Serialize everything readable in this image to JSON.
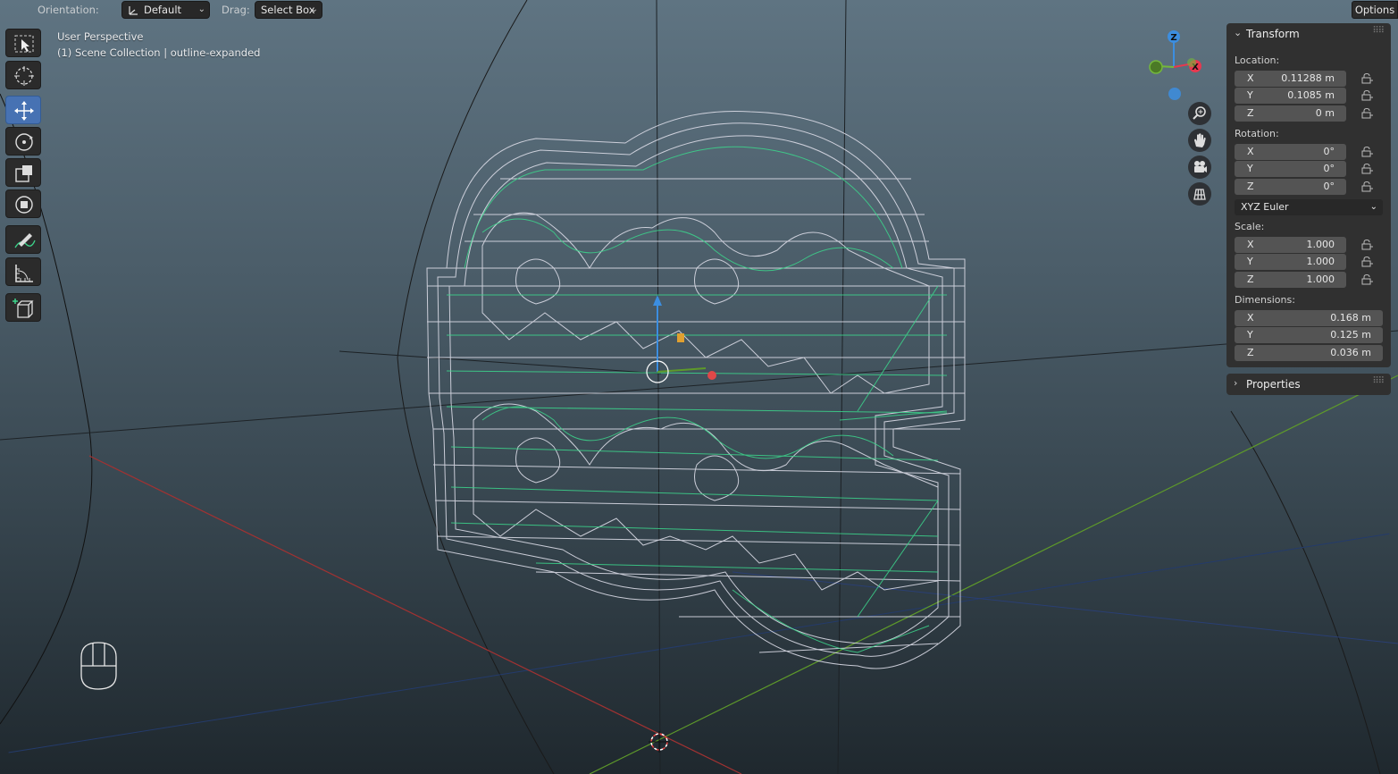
{
  "header": {
    "orientation_label": "Orientation:",
    "orientation_value": "Default",
    "drag_label": "Drag:",
    "drag_value": "Select Box",
    "options_label": "Options"
  },
  "viewport": {
    "view_name": "User Perspective",
    "collection_info": "(1) Scene Collection | outline-expanded"
  },
  "toolbar": {
    "tools": [
      "select-box",
      "cursor",
      "move",
      "rotate",
      "scale",
      "transform",
      "annotate",
      "measure",
      "add-cube"
    ],
    "active_tool": "move"
  },
  "gizmo": {
    "z_label": "Z",
    "x_label": "X",
    "x_color": "#e8384f",
    "y_color": "#74b83b",
    "z_color": "#3c8ee0"
  },
  "nav_buttons": [
    "zoom-icon",
    "pan-hand-icon",
    "camera-icon",
    "grid-ortho-icon"
  ],
  "transform_panel": {
    "title": "Transform",
    "location_label": "Location:",
    "location": [
      {
        "axis": "X",
        "value": "0.11288 m"
      },
      {
        "axis": "Y",
        "value": "0.1085 m"
      },
      {
        "axis": "Z",
        "value": "0 m"
      }
    ],
    "rotation_label": "Rotation:",
    "rotation": [
      {
        "axis": "X",
        "value": "0°"
      },
      {
        "axis": "Y",
        "value": "0°"
      },
      {
        "axis": "Z",
        "value": "0°"
      }
    ],
    "rotation_mode": "XYZ Euler",
    "scale_label": "Scale:",
    "scale": [
      {
        "axis": "X",
        "value": "1.000"
      },
      {
        "axis": "Y",
        "value": "1.000"
      },
      {
        "axis": "Z",
        "value": "1.000"
      }
    ],
    "dimensions_label": "Dimensions:",
    "dimensions": [
      {
        "axis": "X",
        "value": "0.168 m"
      },
      {
        "axis": "Y",
        "value": "0.125 m"
      },
      {
        "axis": "Z",
        "value": "0.036 m"
      }
    ]
  },
  "properties_panel": {
    "title": "Properties"
  },
  "colors": {
    "active_tool": "#4772b3",
    "wire": "#dcdce8",
    "wire_selected": "#3cd68c",
    "x_axis": "#b03030",
    "y_axis": "#5f9e2a"
  }
}
